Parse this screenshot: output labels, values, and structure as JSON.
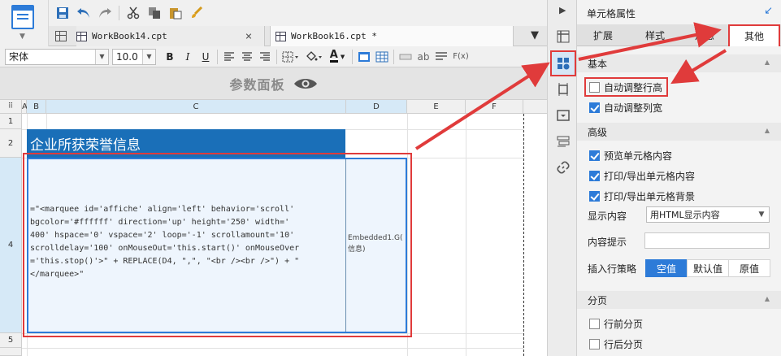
{
  "tabs": [
    {
      "label": "WorkBook14.cpt",
      "close": "×"
    },
    {
      "label": "WorkBook16.cpt *",
      "close": "×"
    }
  ],
  "format": {
    "font": "宋体",
    "size": "10.0",
    "bold": "B",
    "italic": "I",
    "underline": "U",
    "text_color_glyph": "A",
    "ab": "ab",
    "fx": "F(x)"
  },
  "param_panel": {
    "title": "参数面板"
  },
  "sheet": {
    "columns": [
      "A",
      "B",
      "C",
      "D",
      "E",
      "F"
    ],
    "rows": [
      "1",
      "2",
      "4",
      "5"
    ],
    "title_cell": "企业所获荣誉信息",
    "formula_cell": "=\"<marquee id='affiche' align='left' behavior='scroll'\nbgcolor='#ffffff' direction='up' height='250' width='\n400' hspace='0' vspace='2' loop='-1' scrollamount='10'\nscrolldelay='100' onMouseOut='this.start()' onMouseOver\n='this.stop()'>\" + REPLACE(D4, \",\", \"<br /><br />\") + \"\n</marquee>\"",
    "embedded_cell": "Embedded1.G(\n信息)"
  },
  "props": {
    "title": "单元格属性",
    "tabs": [
      "扩展",
      "样式",
      "形态",
      "其他"
    ],
    "sections": {
      "basic": "基本",
      "advanced": "高级",
      "paging": "分页"
    },
    "auto_height": {
      "label": "自动调整行高",
      "checked": false
    },
    "auto_width": {
      "label": "自动调整列宽",
      "checked": true
    },
    "preview": {
      "label": "预览单元格内容",
      "checked": true
    },
    "print_content": {
      "label": "打印/导出单元格内容",
      "checked": true
    },
    "print_bg": {
      "label": "打印/导出单元格背景",
      "checked": true
    },
    "display_label": "显示内容",
    "display_value": "用HTML显示内容",
    "tip_label": "内容提示",
    "tip_value": "",
    "insert_label": "插入行策略",
    "insert_options": [
      "空值",
      "默认值",
      "原值"
    ],
    "insert_selected": "空值",
    "page_before": {
      "label": "行前分页",
      "checked": false
    },
    "page_after": {
      "label": "行后分页",
      "checked": false
    }
  },
  "colors": {
    "accent": "#2d7bd8",
    "annotation": "#e03b3b",
    "title_bg": "#1a6fb8"
  }
}
